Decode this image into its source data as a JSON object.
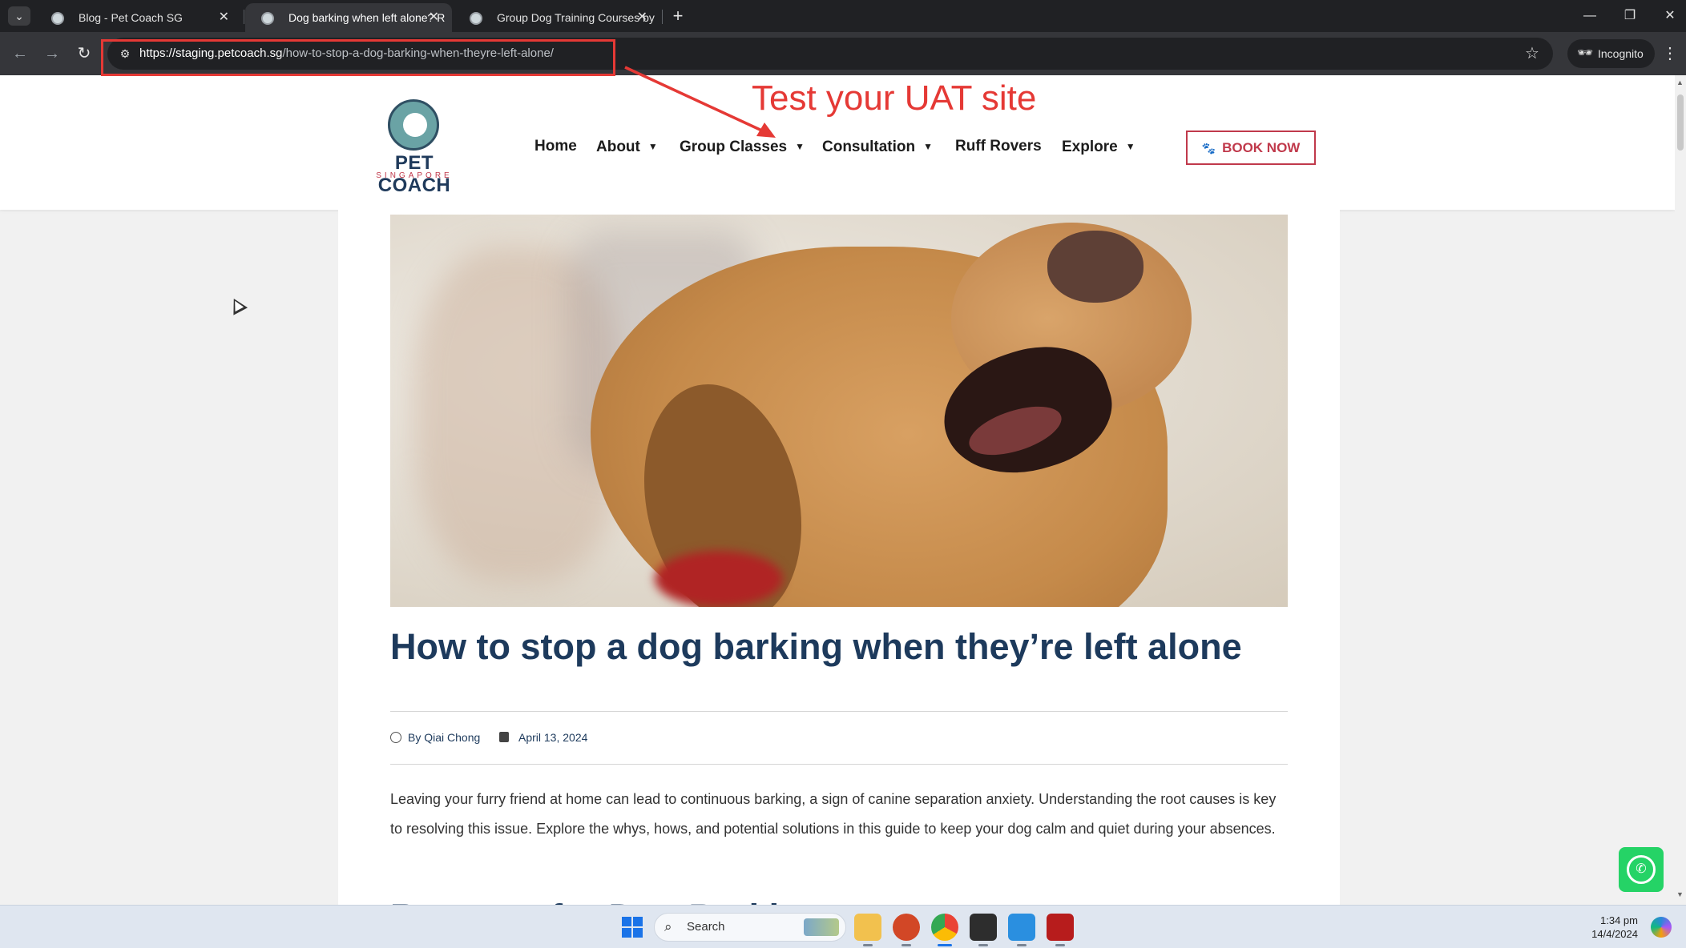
{
  "browser": {
    "tabs": [
      {
        "title": "Blog - Pet Coach SG",
        "active": false
      },
      {
        "title": "Dog barking when left alone? R",
        "active": true
      },
      {
        "title": "Group Dog Training Courses by",
        "active": false
      }
    ],
    "url_host": "https://staging.petcoach.sg",
    "url_path": "/how-to-stop-a-dog-barking-when-theyre-left-alone/",
    "incognito_label": "Incognito"
  },
  "annotation": {
    "text": "Test your UAT site",
    "color": "#e53935"
  },
  "site": {
    "logo": {
      "brand": "PET COACH",
      "tagline": "SINGAPORE"
    },
    "menu": [
      {
        "label": "Home",
        "has_dropdown": false
      },
      {
        "label": "About",
        "has_dropdown": true
      },
      {
        "label": "Group Classes",
        "has_dropdown": true
      },
      {
        "label": "Consultation",
        "has_dropdown": true
      },
      {
        "label": "Ruff Rovers",
        "has_dropdown": false
      },
      {
        "label": "Explore",
        "has_dropdown": true
      }
    ],
    "book_button": "BOOK NOW",
    "colors": {
      "primary": "#1d3a5c",
      "accent": "#c0394b"
    }
  },
  "article": {
    "title": "How to stop a dog barking when they’re left alone",
    "author": "By Qiai Chong",
    "date": "April 13, 2024",
    "intro": "Leaving your furry friend at home can lead to continuous barking, a sign of canine separation anxiety. Understanding the root causes is key to resolving this issue. Explore the whys, hows, and potential solutions in this guide to keep your dog calm and quiet during your absences.",
    "next_heading": "Reasons for Dog Barking"
  },
  "taskbar": {
    "search_placeholder": "Search",
    "time": "1:34 pm",
    "date": "14/4/2024"
  }
}
